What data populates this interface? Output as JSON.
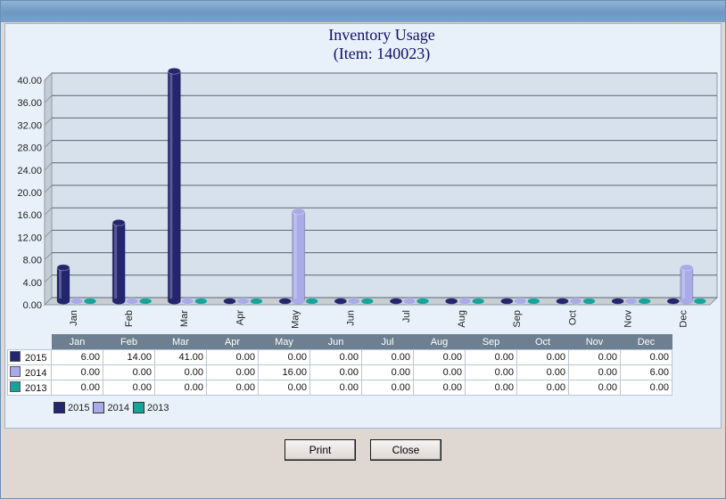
{
  "chart_data": {
    "type": "bar",
    "title": "Inventory Usage",
    "subtitle": "(Item: 140023)",
    "categories": [
      "Jan",
      "Feb",
      "Mar",
      "Apr",
      "May",
      "Jun",
      "Jul",
      "Aug",
      "Sep",
      "Oct",
      "Nov",
      "Dec"
    ],
    "series": [
      {
        "name": "2015",
        "color": "#23256e",
        "values": [
          6,
          14,
          41,
          0,
          0,
          0,
          0,
          0,
          0,
          0,
          0,
          0
        ]
      },
      {
        "name": "2014",
        "color": "#a9aae8",
        "values": [
          0,
          0,
          0,
          0,
          16,
          0,
          0,
          0,
          0,
          0,
          0,
          6
        ]
      },
      {
        "name": "2013",
        "color": "#16a49a",
        "values": [
          0,
          0,
          0,
          0,
          0,
          0,
          0,
          0,
          0,
          0,
          0,
          0
        ]
      }
    ],
    "ylim": [
      0,
      40
    ],
    "yticks": [
      "0.00",
      "4.00",
      "8.00",
      "12.00",
      "16.00",
      "20.00",
      "24.00",
      "28.00",
      "32.00",
      "36.00",
      "40.00"
    ],
    "grid": true,
    "legend_placement": "bottom-left"
  },
  "table": {
    "rows": [
      {
        "label": "2015",
        "cells": [
          "6.00",
          "14.00",
          "41.00",
          "0.00",
          "0.00",
          "0.00",
          "0.00",
          "0.00",
          "0.00",
          "0.00",
          "0.00",
          "0.00"
        ]
      },
      {
        "label": "2014",
        "cells": [
          "0.00",
          "0.00",
          "0.00",
          "0.00",
          "16.00",
          "0.00",
          "0.00",
          "0.00",
          "0.00",
          "0.00",
          "0.00",
          "6.00"
        ]
      },
      {
        "label": "2013",
        "cells": [
          "0.00",
          "0.00",
          "0.00",
          "0.00",
          "0.00",
          "0.00",
          "0.00",
          "0.00",
          "0.00",
          "0.00",
          "0.00",
          "0.00"
        ]
      }
    ]
  },
  "buttons": {
    "print": "Print",
    "close": "Close"
  }
}
